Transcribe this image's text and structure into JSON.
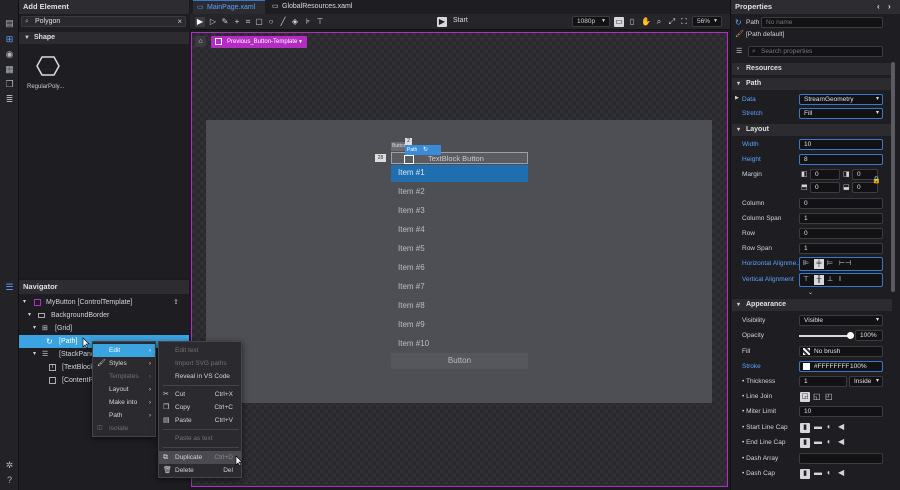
{
  "left_toolbar": {
    "icons": [
      "layers-icon",
      "add-icon",
      "palette-icon",
      "widget-icon",
      "copy-icon",
      "database-icon",
      "list-icon",
      "bug-icon",
      "help-icon"
    ]
  },
  "add_element": {
    "title": "Add Element",
    "search_value": "Polygon",
    "section": "Shape",
    "item_label": "RegularPoly..."
  },
  "navigator": {
    "title": "Navigator",
    "rows": [
      "MyButton [ControlTemplate]",
      "BackgroundBorder",
      "[Grid]",
      "[Path]",
      "[StackPanel]",
      "[TextBlock]",
      "[ContentPr..."
    ]
  },
  "tabs": [
    {
      "label": "MainPage.xaml"
    },
    {
      "label": "GlobalResources.xaml"
    }
  ],
  "toolbar": {
    "start_label": "Start",
    "resolution": "1080p",
    "zoom": "56%"
  },
  "breadcrumb": {
    "label": "Previous_Button-Template"
  },
  "canvas": {
    "header_text": "TextBlock   Button",
    "path_badge": "Path",
    "button_tag": "Button",
    "first_item": "Item #1",
    "items": [
      "Item #2",
      "Item #3",
      "Item #4",
      "Item #5",
      "Item #6",
      "Item #7",
      "Item #8",
      "Item #9",
      "Item #10"
    ],
    "button_label": "Button",
    "measure_left": "28",
    "measure_top": "2"
  },
  "menu_main": [
    {
      "label": "Edit",
      "arrow": "›",
      "active": true
    },
    {
      "label": "Styles",
      "arrow": "›"
    },
    {
      "label": "Templates",
      "arrow": "›",
      "disabled": true
    },
    {
      "label": "Layout",
      "arrow": "›"
    },
    {
      "label": "Make into",
      "arrow": "›"
    },
    {
      "label": "Path",
      "arrow": "›"
    },
    {
      "label": "Isolate",
      "disabled": true
    }
  ],
  "menu_sub": [
    {
      "label": "Edit text",
      "disabled": true
    },
    {
      "label": "Import SVG paths",
      "disabled": true
    },
    {
      "label": "Reveal in VS Code"
    },
    {
      "label": "Cut",
      "shortcut": "Ctrl+X"
    },
    {
      "label": "Copy",
      "shortcut": "Ctrl+C"
    },
    {
      "label": "Paste",
      "shortcut": "Ctrl+V"
    },
    {
      "label": "Paste as text",
      "disabled": true
    },
    {
      "label": "Duplicate",
      "shortcut": "Ctrl+D",
      "hover": true
    },
    {
      "label": "Delete",
      "shortcut": "Del"
    }
  ],
  "properties": {
    "title": "Properties",
    "type_name": "Path",
    "name_placeholder": "No name",
    "style_label": "[Path default]",
    "search_placeholder": "Search properties",
    "sections": {
      "resources": "Resources",
      "path": "Path",
      "layout": "Layout",
      "appearance": "Appearance"
    },
    "data_label": "Data",
    "data_value": "StreamGeometry",
    "stretch_label": "Stretch",
    "stretch_value": "Fill",
    "width_label": "Width",
    "width_value": "10",
    "height_label": "Height",
    "height_value": "8",
    "margin_label": "Margin",
    "margin_values": [
      "0",
      "0",
      "0",
      "0"
    ],
    "column_label": "Column",
    "column_value": "0",
    "colspan_label": "Column Span",
    "colspan_value": "1",
    "row_label": "Row",
    "row_value": "0",
    "rowspan_label": "Row Span",
    "rowspan_value": "1",
    "halign_label": "Horizontal Alignme...",
    "valign_label": "Vertical Alignment",
    "visibility_label": "Visibility",
    "visibility_value": "Visible",
    "opacity_label": "Opacity",
    "opacity_value": "100%",
    "fill_label": "Fill",
    "fill_value": "No brush",
    "stroke_label": "Stroke",
    "stroke_value": "#FFFFFFFF",
    "stroke_pct": "100%",
    "thickness_label": "Thickness",
    "thickness_value": "1",
    "thickness_mode": "Inside",
    "linejoin_label": "Line Join",
    "miter_label": "Miter Limit",
    "miter_value": "10",
    "startcap_label": "Start Line Cap",
    "endcap_label": "End Line Cap",
    "dasharray_label": "Dash Array",
    "dashcap_label": "Dash Cap",
    "colors": {
      "accent": "#1e6fb5",
      "selection": "#b52cc4",
      "stroke_swatch": "#FFFFFF"
    }
  }
}
